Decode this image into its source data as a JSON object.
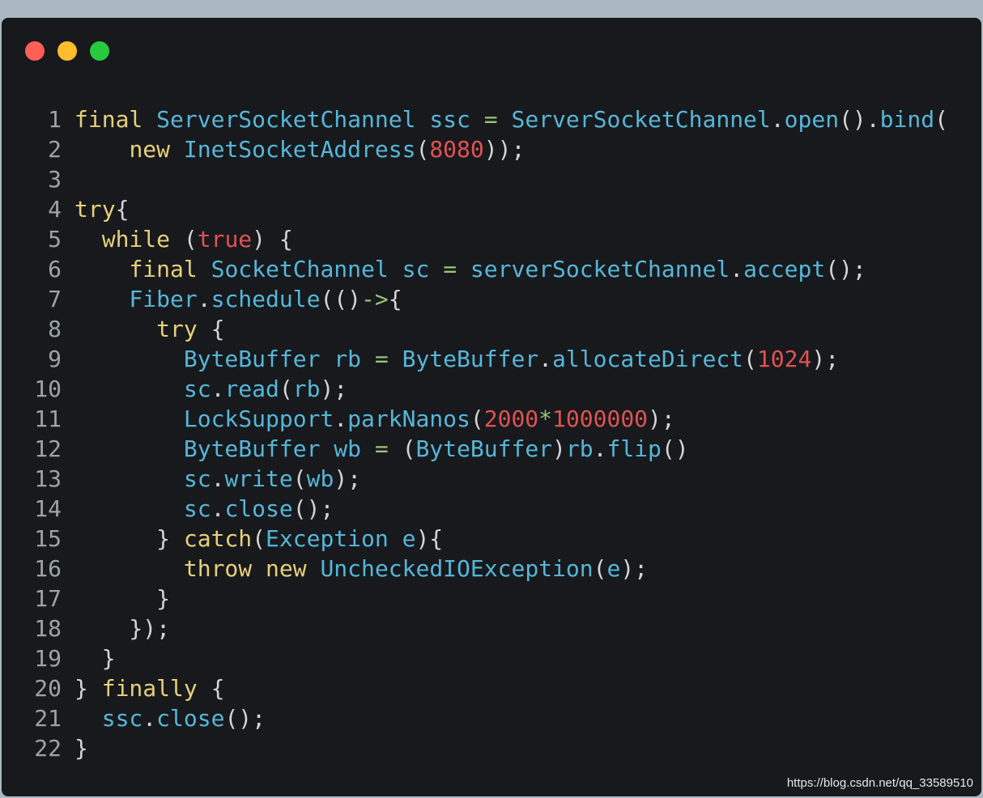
{
  "window": {
    "buttons": [
      {
        "name": "close",
        "color": "#ff5f56"
      },
      {
        "name": "minimize",
        "color": "#ffbd2e"
      },
      {
        "name": "zoom",
        "color": "#27c93f"
      }
    ]
  },
  "code": {
    "lines": [
      {
        "n": "1",
        "tokens": [
          [
            "kw",
            "final"
          ],
          [
            "pl",
            " "
          ],
          [
            "ty",
            "ServerSocketChannel"
          ],
          [
            "pl",
            " "
          ],
          [
            "ty",
            "ssc"
          ],
          [
            "pl",
            " "
          ],
          [
            "op",
            "="
          ],
          [
            "pl",
            " "
          ],
          [
            "ty",
            "ServerSocketChannel"
          ],
          [
            "pl",
            "."
          ],
          [
            "fn",
            "open"
          ],
          [
            "pl",
            "()."
          ],
          [
            "fn",
            "bind"
          ],
          [
            "pl",
            "("
          ]
        ]
      },
      {
        "n": "2",
        "tokens": [
          [
            "pl",
            "    "
          ],
          [
            "kw",
            "new"
          ],
          [
            "pl",
            " "
          ],
          [
            "ty",
            "InetSocketAddress"
          ],
          [
            "pl",
            "("
          ],
          [
            "num",
            "8080"
          ],
          [
            "pl",
            "));"
          ]
        ]
      },
      {
        "n": "3",
        "tokens": []
      },
      {
        "n": "4",
        "tokens": [
          [
            "kw",
            "try"
          ],
          [
            "pl",
            "{"
          ]
        ]
      },
      {
        "n": "5",
        "tokens": [
          [
            "pl",
            "  "
          ],
          [
            "kw",
            "while"
          ],
          [
            "pl",
            " ("
          ],
          [
            "bool",
            "true"
          ],
          [
            "pl",
            ") {"
          ]
        ]
      },
      {
        "n": "6",
        "tokens": [
          [
            "pl",
            "    "
          ],
          [
            "kw",
            "final"
          ],
          [
            "pl",
            " "
          ],
          [
            "ty",
            "SocketChannel"
          ],
          [
            "pl",
            " "
          ],
          [
            "ty",
            "sc"
          ],
          [
            "pl",
            " "
          ],
          [
            "op",
            "="
          ],
          [
            "pl",
            " "
          ],
          [
            "ty",
            "serverSocketChannel"
          ],
          [
            "pl",
            "."
          ],
          [
            "fn",
            "accept"
          ],
          [
            "pl",
            "();"
          ]
        ]
      },
      {
        "n": "7",
        "tokens": [
          [
            "pl",
            "    "
          ],
          [
            "ty",
            "Fiber"
          ],
          [
            "pl",
            "."
          ],
          [
            "fn",
            "schedule"
          ],
          [
            "pl",
            "(()"
          ],
          [
            "op",
            "->"
          ],
          [
            "pl",
            "{"
          ]
        ]
      },
      {
        "n": "8",
        "tokens": [
          [
            "pl",
            "      "
          ],
          [
            "kw",
            "try"
          ],
          [
            "pl",
            " {"
          ]
        ]
      },
      {
        "n": "9",
        "tokens": [
          [
            "pl",
            "        "
          ],
          [
            "ty",
            "ByteBuffer"
          ],
          [
            "pl",
            " "
          ],
          [
            "ty",
            "rb"
          ],
          [
            "pl",
            " "
          ],
          [
            "op",
            "="
          ],
          [
            "pl",
            " "
          ],
          [
            "ty",
            "ByteBuffer"
          ],
          [
            "pl",
            "."
          ],
          [
            "fn",
            "allocateDirect"
          ],
          [
            "pl",
            "("
          ],
          [
            "num",
            "1024"
          ],
          [
            "pl",
            ");"
          ]
        ]
      },
      {
        "n": "10",
        "tokens": [
          [
            "pl",
            "        "
          ],
          [
            "ty",
            "sc"
          ],
          [
            "pl",
            "."
          ],
          [
            "fn",
            "read"
          ],
          [
            "pl",
            "("
          ],
          [
            "ty",
            "rb"
          ],
          [
            "pl",
            ");"
          ]
        ]
      },
      {
        "n": "11",
        "tokens": [
          [
            "pl",
            "        "
          ],
          [
            "ty",
            "LockSupport"
          ],
          [
            "pl",
            "."
          ],
          [
            "fn",
            "parkNanos"
          ],
          [
            "pl",
            "("
          ],
          [
            "num",
            "2000"
          ],
          [
            "op",
            "*"
          ],
          [
            "num",
            "1000000"
          ],
          [
            "pl",
            ");"
          ]
        ]
      },
      {
        "n": "12",
        "tokens": [
          [
            "pl",
            "        "
          ],
          [
            "ty",
            "ByteBuffer"
          ],
          [
            "pl",
            " "
          ],
          [
            "ty",
            "wb"
          ],
          [
            "pl",
            " "
          ],
          [
            "op",
            "="
          ],
          [
            "pl",
            " ("
          ],
          [
            "ty",
            "ByteBuffer"
          ],
          [
            "pl",
            ")"
          ],
          [
            "ty",
            "rb"
          ],
          [
            "pl",
            "."
          ],
          [
            "fn",
            "flip"
          ],
          [
            "pl",
            "()"
          ]
        ]
      },
      {
        "n": "13",
        "tokens": [
          [
            "pl",
            "        "
          ],
          [
            "ty",
            "sc"
          ],
          [
            "pl",
            "."
          ],
          [
            "fn",
            "write"
          ],
          [
            "pl",
            "("
          ],
          [
            "ty",
            "wb"
          ],
          [
            "pl",
            ");"
          ]
        ]
      },
      {
        "n": "14",
        "tokens": [
          [
            "pl",
            "        "
          ],
          [
            "ty",
            "sc"
          ],
          [
            "pl",
            "."
          ],
          [
            "fn",
            "close"
          ],
          [
            "pl",
            "();"
          ]
        ]
      },
      {
        "n": "15",
        "tokens": [
          [
            "pl",
            "      } "
          ],
          [
            "kw",
            "catch"
          ],
          [
            "pl",
            "("
          ],
          [
            "ty",
            "Exception"
          ],
          [
            "pl",
            " "
          ],
          [
            "ty",
            "e"
          ],
          [
            "pl",
            "){"
          ]
        ]
      },
      {
        "n": "16",
        "tokens": [
          [
            "pl",
            "        "
          ],
          [
            "kw",
            "throw"
          ],
          [
            "pl",
            " "
          ],
          [
            "kw",
            "new"
          ],
          [
            "pl",
            " "
          ],
          [
            "ty",
            "UncheckedIOException"
          ],
          [
            "pl",
            "("
          ],
          [
            "ty",
            "e"
          ],
          [
            "pl",
            ");"
          ]
        ]
      },
      {
        "n": "17",
        "tokens": [
          [
            "pl",
            "      }"
          ]
        ]
      },
      {
        "n": "18",
        "tokens": [
          [
            "pl",
            "    });"
          ]
        ]
      },
      {
        "n": "19",
        "tokens": [
          [
            "pl",
            "  }"
          ]
        ]
      },
      {
        "n": "20",
        "tokens": [
          [
            "pl",
            "} "
          ],
          [
            "kw",
            "finally"
          ],
          [
            "pl",
            " {"
          ]
        ]
      },
      {
        "n": "21",
        "tokens": [
          [
            "pl",
            "  "
          ],
          [
            "ty",
            "ssc"
          ],
          [
            "pl",
            "."
          ],
          [
            "fn",
            "close"
          ],
          [
            "pl",
            "();"
          ]
        ]
      },
      {
        "n": "22",
        "tokens": [
          [
            "pl",
            "}"
          ]
        ]
      }
    ]
  },
  "watermark": "https://blog.csdn.net/qq_33589510"
}
